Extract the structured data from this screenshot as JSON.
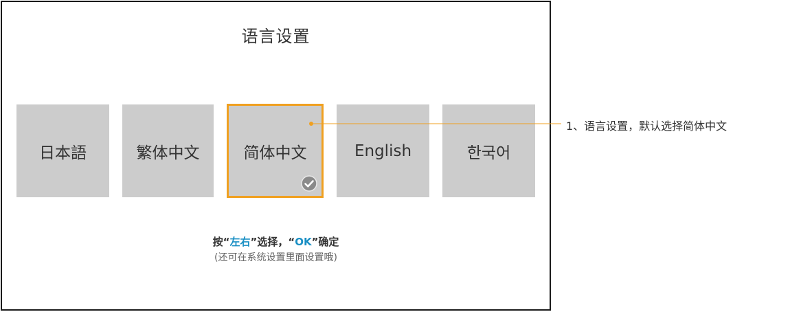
{
  "screen": {
    "title": "语言设置",
    "languages": [
      {
        "label": "日本語",
        "selected": false
      },
      {
        "label": "繁体中文",
        "selected": false
      },
      {
        "label": "简体中文",
        "selected": true
      },
      {
        "label": "English",
        "selected": false
      },
      {
        "label": "한국어",
        "selected": false
      }
    ],
    "hint": {
      "prefix": "按",
      "q1": "“",
      "key_left_right": "左右",
      "q2": "”",
      "middle": "选择，",
      "q3": "“",
      "key_ok": "OK",
      "q4": "”",
      "suffix": "确定"
    },
    "subhint": "(还可在系统设置里面设置哦)"
  },
  "annotation": {
    "text": "1、语言设置，默认选择简体中文"
  },
  "colors": {
    "tile_bg": "#cccccc",
    "selected_border": "#f0a020",
    "accent": "#1a8fc4",
    "annotation_line": "#f0a020"
  },
  "icons": {
    "selected_check": "check-circle-icon",
    "annotation_dot": "dot-marker-icon"
  }
}
